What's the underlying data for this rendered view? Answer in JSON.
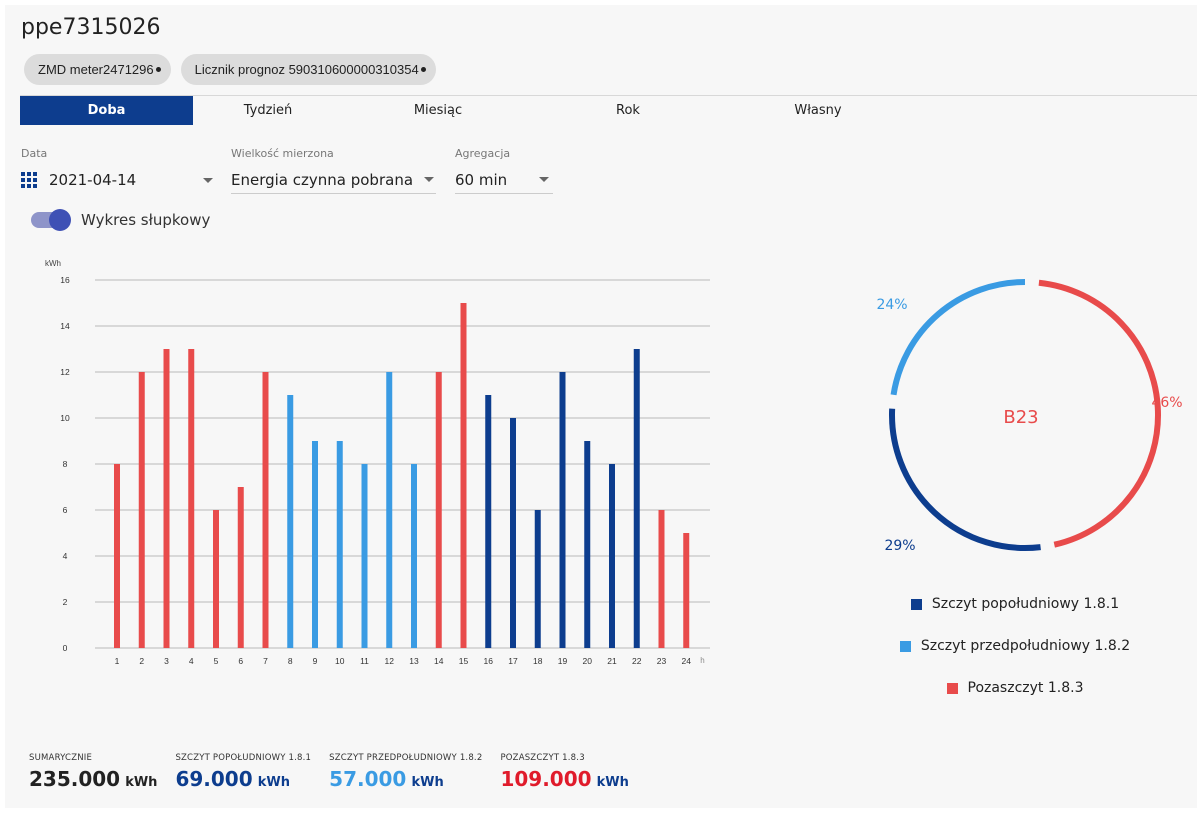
{
  "header": {
    "title": "ppe7315026"
  },
  "chips": [
    {
      "label": "ZMD meter2471296"
    },
    {
      "label": "Licznik prognoz 590310600000310354"
    }
  ],
  "tabs": [
    {
      "label": "Doba",
      "active": true
    },
    {
      "label": "Tydzień"
    },
    {
      "label": "Miesiąc"
    },
    {
      "label": "Rok"
    },
    {
      "label": "Własny"
    }
  ],
  "filters": {
    "date_label": "Data",
    "date_value": "2021-04-14",
    "quantity_label": "Wielkość mierzona",
    "quantity_value": "Energia czynna pobrana",
    "aggregation_label": "Agregacja",
    "aggregation_value": "60 min"
  },
  "toggle": {
    "label": "Wykres słupkowy",
    "on": true
  },
  "colors": {
    "afternoon_peak": "#0d3d8e",
    "morning_peak": "#3a9be3",
    "off_peak": "#e84b4b"
  },
  "chart_data": [
    {
      "type": "bar",
      "ylabel": "kWh",
      "xlabel": "h",
      "ylim": [
        0,
        16
      ],
      "yticks": [
        0,
        2,
        4,
        6,
        8,
        10,
        12,
        14,
        16
      ],
      "grid": true,
      "categories": [
        "1",
        "2",
        "3",
        "4",
        "5",
        "6",
        "7",
        "8",
        "9",
        "10",
        "11",
        "12",
        "13",
        "14",
        "15",
        "16",
        "17",
        "18",
        "19",
        "20",
        "21",
        "22",
        "23",
        "24"
      ],
      "values": [
        8,
        12,
        13,
        13,
        6,
        7,
        12,
        11,
        9,
        9,
        8,
        12,
        8,
        12,
        15,
        11,
        10,
        6,
        12,
        9,
        8,
        13,
        6,
        5
      ],
      "zones": [
        "off",
        "off",
        "off",
        "off",
        "off",
        "off",
        "off",
        "morning",
        "morning",
        "morning",
        "morning",
        "morning",
        "morning",
        "off",
        "off",
        "afternoon",
        "afternoon",
        "afternoon",
        "afternoon",
        "afternoon",
        "afternoon",
        "afternoon",
        "off",
        "off"
      ]
    },
    {
      "type": "pie",
      "center_label": "B23",
      "slices": [
        {
          "name": "Szczyt popołudniowy 1.8.1",
          "value": 29,
          "label": "29%"
        },
        {
          "name": "Szczyt przedpołudniowy 1.8.2",
          "value": 24,
          "label": "24%"
        },
        {
          "name": "Pozaszczyt 1.8.3",
          "value": 46,
          "label": "46%"
        }
      ]
    }
  ],
  "legend": [
    {
      "label": "Szczyt popołudniowy 1.8.1",
      "color": "#0d3d8e"
    },
    {
      "label": "Szczyt przedpołudniowy 1.8.2",
      "color": "#3a9be3"
    },
    {
      "label": "Pozaszczyt 1.8.3",
      "color": "#e84b4b"
    }
  ],
  "summary": [
    {
      "label": "SUMARYCZNIE",
      "value": "235.000",
      "unit": "kWh",
      "color": "#222222"
    },
    {
      "label": "SZCZYT POPOŁUDNIOWY 1.8.1",
      "value": "69.000",
      "unit": "kWh",
      "color": "#0d3d8e"
    },
    {
      "label": "SZCZYT PRZEDPOŁUDNIOWY 1.8.2",
      "value": "57.000",
      "unit": "kWh",
      "color": "#3a9be3"
    },
    {
      "label": "POZASZCZYT 1.8.3",
      "value": "109.000",
      "unit": "kWh",
      "color": "#e01b2b"
    }
  ]
}
